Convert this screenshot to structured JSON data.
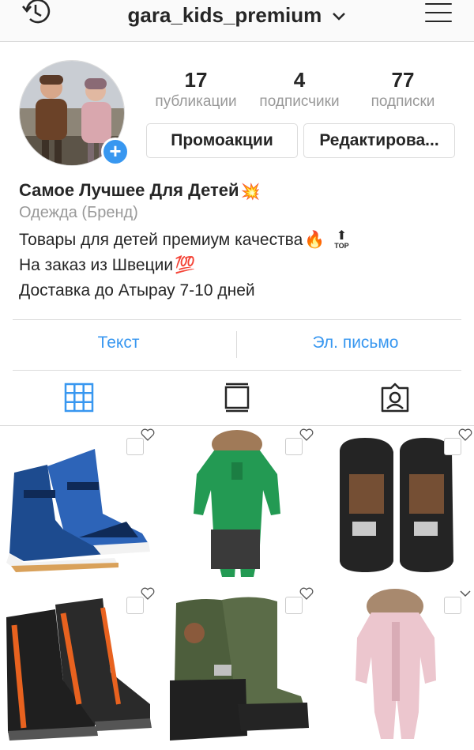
{
  "header": {
    "username": "gara_kids_premium",
    "history_icon": "history-clock-icon",
    "dropdown_icon": "chevron-down-icon",
    "menu_icon": "hamburger-menu-icon"
  },
  "profile": {
    "stats": [
      {
        "value": "17",
        "label": "публикации"
      },
      {
        "value": "4",
        "label": "подписчики"
      },
      {
        "value": "77",
        "label": "подписки"
      }
    ],
    "buttons": {
      "promo": "Промоакции",
      "edit": "Редактирова..."
    },
    "add_icon": "plus-icon"
  },
  "bio": {
    "name": "Самое Лучшее Для Детей",
    "name_emoji": "💥",
    "category": "Одежда (Бренд)",
    "line1": "Товары для детей премиум качества",
    "line1_emoji": "🔥",
    "line1_badge": "TOP",
    "line2": "На заказ из Швеции",
    "line2_emoji": "💯",
    "line3": "Доставка до Атырау 7-10 дней"
  },
  "contact": {
    "text_label": "Текст",
    "email_label": "Эл. письмо"
  },
  "tabs": [
    "grid-icon",
    "feed-icon",
    "tagged-icon"
  ],
  "colors": {
    "accent": "#3897f0",
    "text": "#262626",
    "muted": "#999999",
    "border": "#dbdbdb"
  }
}
